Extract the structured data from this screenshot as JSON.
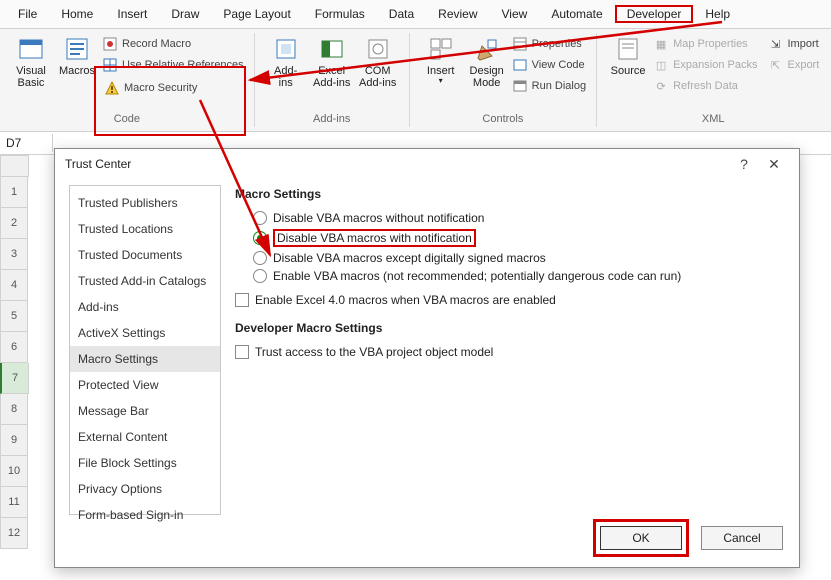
{
  "menu": {
    "items": [
      "File",
      "Home",
      "Insert",
      "Draw",
      "Page Layout",
      "Formulas",
      "Data",
      "Review",
      "View",
      "Automate",
      "Developer",
      "Help"
    ]
  },
  "ribbon": {
    "code": {
      "label": "Code",
      "visual_basic": "Visual\nBasic",
      "macros": "Macros",
      "record": "Record Macro",
      "relative": "Use Relative References",
      "security": "Macro Security"
    },
    "addins": {
      "label": "Add-ins",
      "addins": "Add-\nins",
      "excel": "Excel\nAdd-ins",
      "com": "COM\nAdd-ins"
    },
    "controls": {
      "label": "Controls",
      "insert": "Insert",
      "design": "Design\nMode",
      "properties": "Properties",
      "viewcode": "View Code",
      "rundialog": "Run Dialog"
    },
    "xml": {
      "label": "XML",
      "source": "Source",
      "mapprops": "Map Properties",
      "expansion": "Expansion Packs",
      "refresh": "Refresh Data",
      "import": "Import",
      "export": "Export"
    }
  },
  "cellref": "D7",
  "rows": [
    "1",
    "2",
    "3",
    "4",
    "5",
    "6",
    "7",
    "8",
    "9",
    "10",
    "11",
    "12"
  ],
  "dialog": {
    "title": "Trust Center",
    "categories": [
      "Trusted Publishers",
      "Trusted Locations",
      "Trusted Documents",
      "Trusted Add-in Catalogs",
      "Add-ins",
      "ActiveX Settings",
      "Macro Settings",
      "Protected View",
      "Message Bar",
      "External Content",
      "File Block Settings",
      "Privacy Options",
      "Form-based Sign-in"
    ],
    "selected_category": "Macro Settings",
    "macro_header": "Macro Settings",
    "radios": [
      "Disable VBA macros without notification",
      "Disable VBA macros with notification",
      "Disable VBA macros except digitally signed macros",
      "Enable VBA macros (not recommended; potentially dangerous code can run)"
    ],
    "selected_radio": 1,
    "chk_excel4": "Enable Excel 4.0 macros when VBA macros are enabled",
    "dev_header": "Developer Macro Settings",
    "chk_trust": "Trust access to the VBA project object model",
    "ok": "OK",
    "cancel": "Cancel"
  }
}
